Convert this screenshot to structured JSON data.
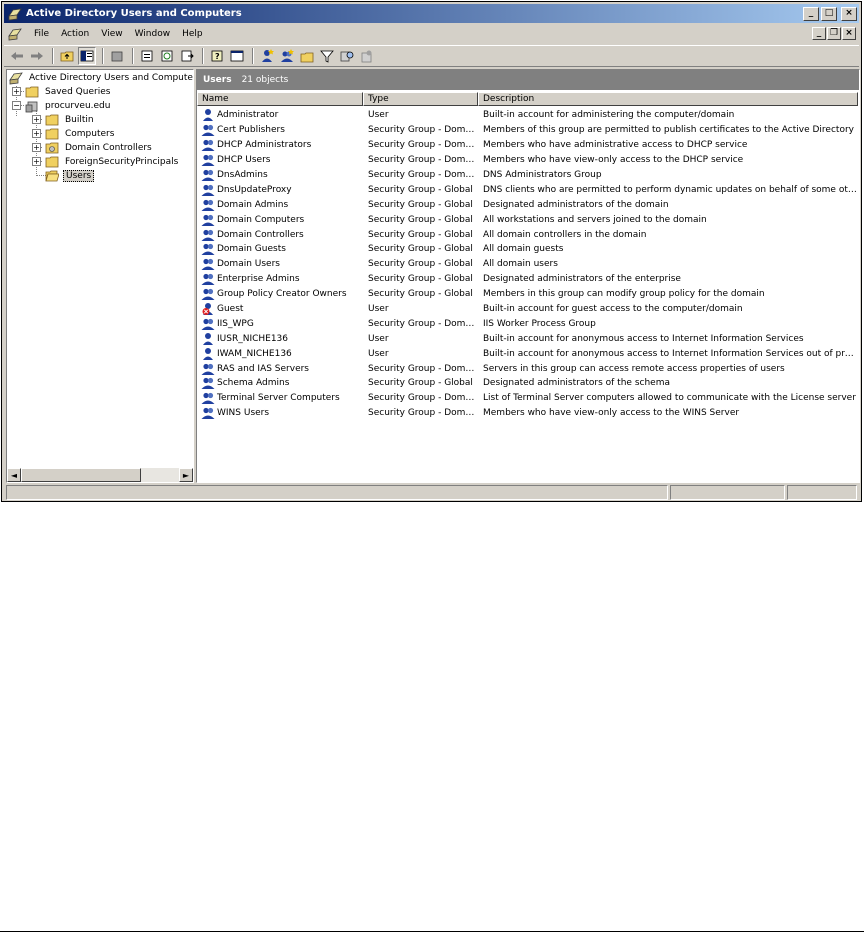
{
  "window": {
    "title": "Active Directory Users and Computers"
  },
  "window_buttons": {
    "minimize": "_",
    "maximize": "□",
    "close": "×"
  },
  "mdi_buttons": {
    "minimize": "_",
    "restore": "❐",
    "close": "×"
  },
  "menu": [
    {
      "label": "File"
    },
    {
      "label": "Action"
    },
    {
      "label": "View"
    },
    {
      "label": "Window"
    },
    {
      "label": "Help"
    }
  ],
  "toolbar": {
    "icons": [
      "back-arrow-icon",
      "forward-arrow-icon",
      "up-folder-icon",
      "show-hide-tree-icon",
      "delete-icon",
      "properties-icon",
      "refresh-icon",
      "export-list-icon",
      "help-icon",
      "console-icon",
      "new-user-icon",
      "new-group-icon",
      "new-ou-icon",
      "filter-icon",
      "find-icon",
      "add-to-group-icon"
    ]
  },
  "tree": {
    "root": "Active Directory Users and Computers",
    "saved_queries": "Saved Queries",
    "domain": "procurveu.edu",
    "children": [
      "Builtin",
      "Computers",
      "Domain Controllers",
      "ForeignSecurityPrincipals",
      "Users"
    ],
    "selected": "Users",
    "expander_plus": "+",
    "expander_minus": "−"
  },
  "list": {
    "header_title": "Users",
    "header_count": "21 objects",
    "columns": [
      "Name",
      "Type",
      "Description"
    ],
    "rows": [
      {
        "name": "Administrator",
        "type": "User",
        "desc": "Built-in account for administering the computer/domain",
        "icon": "user"
      },
      {
        "name": "Cert Publishers",
        "type": "Security Group - Doma...",
        "desc": "Members of this group are permitted to publish certificates to the Active Directory",
        "icon": "group"
      },
      {
        "name": "DHCP Administrators",
        "type": "Security Group - Doma...",
        "desc": "Members who have administrative access to DHCP service",
        "icon": "group"
      },
      {
        "name": "DHCP Users",
        "type": "Security Group - Doma...",
        "desc": "Members who have view-only access to the DHCP service",
        "icon": "group"
      },
      {
        "name": "DnsAdmins",
        "type": "Security Group - Doma...",
        "desc": "DNS Administrators Group",
        "icon": "group"
      },
      {
        "name": "DnsUpdateProxy",
        "type": "Security Group - Global",
        "desc": "DNS clients who are permitted to perform dynamic updates on behalf of some othe...",
        "icon": "group"
      },
      {
        "name": "Domain Admins",
        "type": "Security Group - Global",
        "desc": "Designated administrators of the domain",
        "icon": "group"
      },
      {
        "name": "Domain Computers",
        "type": "Security Group - Global",
        "desc": "All workstations and servers joined to the domain",
        "icon": "group"
      },
      {
        "name": "Domain Controllers",
        "type": "Security Group - Global",
        "desc": "All domain controllers in the domain",
        "icon": "group"
      },
      {
        "name": "Domain Guests",
        "type": "Security Group - Global",
        "desc": "All domain guests",
        "icon": "group"
      },
      {
        "name": "Domain Users",
        "type": "Security Group - Global",
        "desc": "All domain users",
        "icon": "group"
      },
      {
        "name": "Enterprise Admins",
        "type": "Security Group - Global",
        "desc": "Designated administrators of the enterprise",
        "icon": "group"
      },
      {
        "name": "Group Policy Creator Owners",
        "type": "Security Group - Global",
        "desc": "Members in this group can modify group policy for the domain",
        "icon": "group"
      },
      {
        "name": "Guest",
        "type": "User",
        "desc": "Built-in account for guest access to the computer/domain",
        "icon": "disabled-user"
      },
      {
        "name": "IIS_WPG",
        "type": "Security Group - Doma...",
        "desc": "IIS Worker Process Group",
        "icon": "group"
      },
      {
        "name": "IUSR_NICHE136",
        "type": "User",
        "desc": "Built-in account for anonymous access to Internet Information Services",
        "icon": "user"
      },
      {
        "name": "IWAM_NICHE136",
        "type": "User",
        "desc": "Built-in account for anonymous access to Internet Information Services out of proc...",
        "icon": "user"
      },
      {
        "name": "RAS and IAS Servers",
        "type": "Security Group - Doma...",
        "desc": "Servers in this group can access remote access properties of users",
        "icon": "group"
      },
      {
        "name": "Schema Admins",
        "type": "Security Group - Global",
        "desc": "Designated administrators of the schema",
        "icon": "group"
      },
      {
        "name": "Terminal Server Computers",
        "type": "Security Group - Doma...",
        "desc": "List of Terminal Server computers allowed to communicate with the License server",
        "icon": "group"
      },
      {
        "name": "WINS Users",
        "type": "Security Group - Doma...",
        "desc": "Members who have view-only access to the WINS Server",
        "icon": "group"
      }
    ]
  },
  "scroll": {
    "left": "◄",
    "right": "►"
  },
  "colors": {
    "titlebar_start": "#0a246a",
    "titlebar_end": "#a6caf0",
    "face": "#d4d0c8",
    "header": "#808080"
  }
}
